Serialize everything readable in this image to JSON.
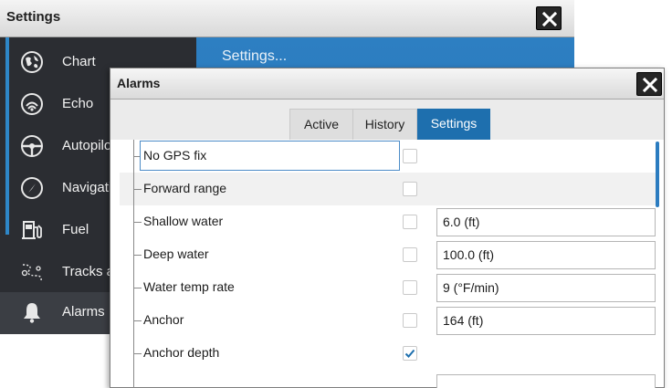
{
  "settings_window": {
    "title": "Settings",
    "content_header": "Settings...",
    "sidebar": [
      {
        "label": "Chart",
        "icon": "chart-globe-icon"
      },
      {
        "label": "Echo",
        "icon": "echo-sonar-icon"
      },
      {
        "label": "Autopilo",
        "icon": "autopilot-wheel-icon"
      },
      {
        "label": "Navigati",
        "icon": "navigation-compass-icon"
      },
      {
        "label": "Fuel",
        "icon": "fuel-pump-icon"
      },
      {
        "label": "Tracks a",
        "icon": "tracks-icon"
      },
      {
        "label": "Alarms",
        "icon": "alarm-bell-icon"
      }
    ]
  },
  "alarms_dialog": {
    "title": "Alarms",
    "tabs": {
      "active": "Active",
      "history": "History",
      "settings": "Settings"
    },
    "selected_tab": "Settings",
    "rows": [
      {
        "name": "No GPS fix",
        "checked": false,
        "value": null
      },
      {
        "name": "Forward range",
        "checked": false,
        "value": null
      },
      {
        "name": "Shallow water",
        "checked": false,
        "value": "6.0 (ft)"
      },
      {
        "name": "Deep water",
        "checked": false,
        "value": "100.0 (ft)"
      },
      {
        "name": "Water temp rate",
        "checked": false,
        "value": "9 (°F/min)"
      },
      {
        "name": "Anchor",
        "checked": false,
        "value": "164 (ft)"
      },
      {
        "name": "Anchor depth",
        "checked": true,
        "value": null
      }
    ]
  },
  "colors": {
    "accent": "#2e87c8",
    "tab_selected": "#1e6fae",
    "dark_bg": "#2b2d32"
  }
}
